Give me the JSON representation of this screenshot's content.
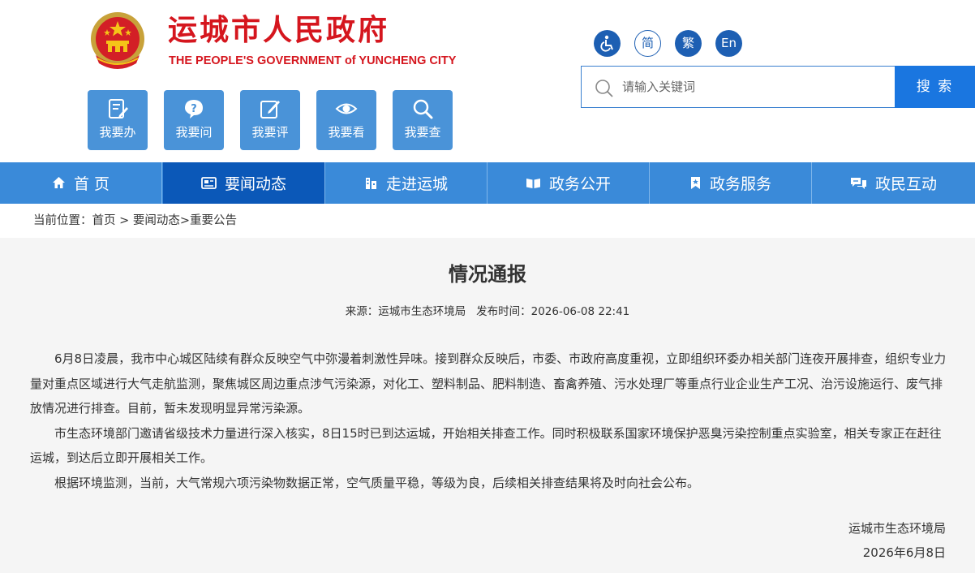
{
  "header": {
    "title": "运城市人民政府",
    "subtitle": "THE PEOPLE'S GOVERNMENT of YUNCHENG CITY"
  },
  "quick_links": [
    {
      "label": "我要办",
      "icon": "edit-doc-icon"
    },
    {
      "label": "我要问",
      "icon": "question-bubble-icon"
    },
    {
      "label": "我要评",
      "icon": "pen-icon"
    },
    {
      "label": "我要看",
      "icon": "eye-icon"
    },
    {
      "label": "我要查",
      "icon": "search-icon"
    }
  ],
  "tools": {
    "accessibility_icon": "wheelchair-icon",
    "simplified": "简",
    "traditional": "繁",
    "english": "En"
  },
  "search": {
    "placeholder": "请输入关键词",
    "button": "搜 索"
  },
  "nav": [
    {
      "label": "首 页",
      "icon": "home-icon"
    },
    {
      "label": "要闻动态",
      "icon": "newspaper-icon"
    },
    {
      "label": "走进运城",
      "icon": "building-icon"
    },
    {
      "label": "政务公开",
      "icon": "book-icon"
    },
    {
      "label": "政务服务",
      "icon": "bookmark-icon"
    },
    {
      "label": "政民互动",
      "icon": "chat-icon"
    }
  ],
  "breadcrumb": {
    "prefix": "当前位置：",
    "home": "首页",
    "sep": " > ",
    "section": "要闻动态",
    "sep2": ">",
    "current": "重要公告"
  },
  "article": {
    "title": "情况通报",
    "source_label": "来源：",
    "source": "运城市生态环境局",
    "time_label": "发布时间：",
    "time": "2026-06-08 22:41",
    "paragraphs": [
      "6月8日凌晨，我市中心城区陆续有群众反映空气中弥漫着刺激性异味。接到群众反映后，市委、市政府高度重视，立即组织环委办相关部门连夜开展排查，组织专业力量对重点区域进行大气走航监测，聚焦城区周边重点涉气污染源，对化工、塑料制品、肥料制造、畜禽养殖、污水处理厂等重点行业企业生产工况、治污设施运行、废气排放情况进行排查。目前，暂未发现明显异常污染源。",
      "市生态环境部门邀请省级技术力量进行深入核实，8日15时已到达运城，开始相关排查工作。同时积极联系国家环境保护恶臭污染控制重点实验室，相关专家正在赶往运城，到达后立即开展相关工作。",
      "根据环境监测，当前，大气常规六项污染物数据正常，空气质量平稳，等级为良，后续相关排查结果将及时向社会公布。"
    ],
    "signature": "运城市生态环境局",
    "date": "2026年6月8日"
  },
  "colors": {
    "brand_red": "#d5161e",
    "nav_blue": "#3a8ad9",
    "nav_active": "#0b58b8",
    "quick_blue": "#4a93d8",
    "search_blue": "#1a76e0"
  }
}
